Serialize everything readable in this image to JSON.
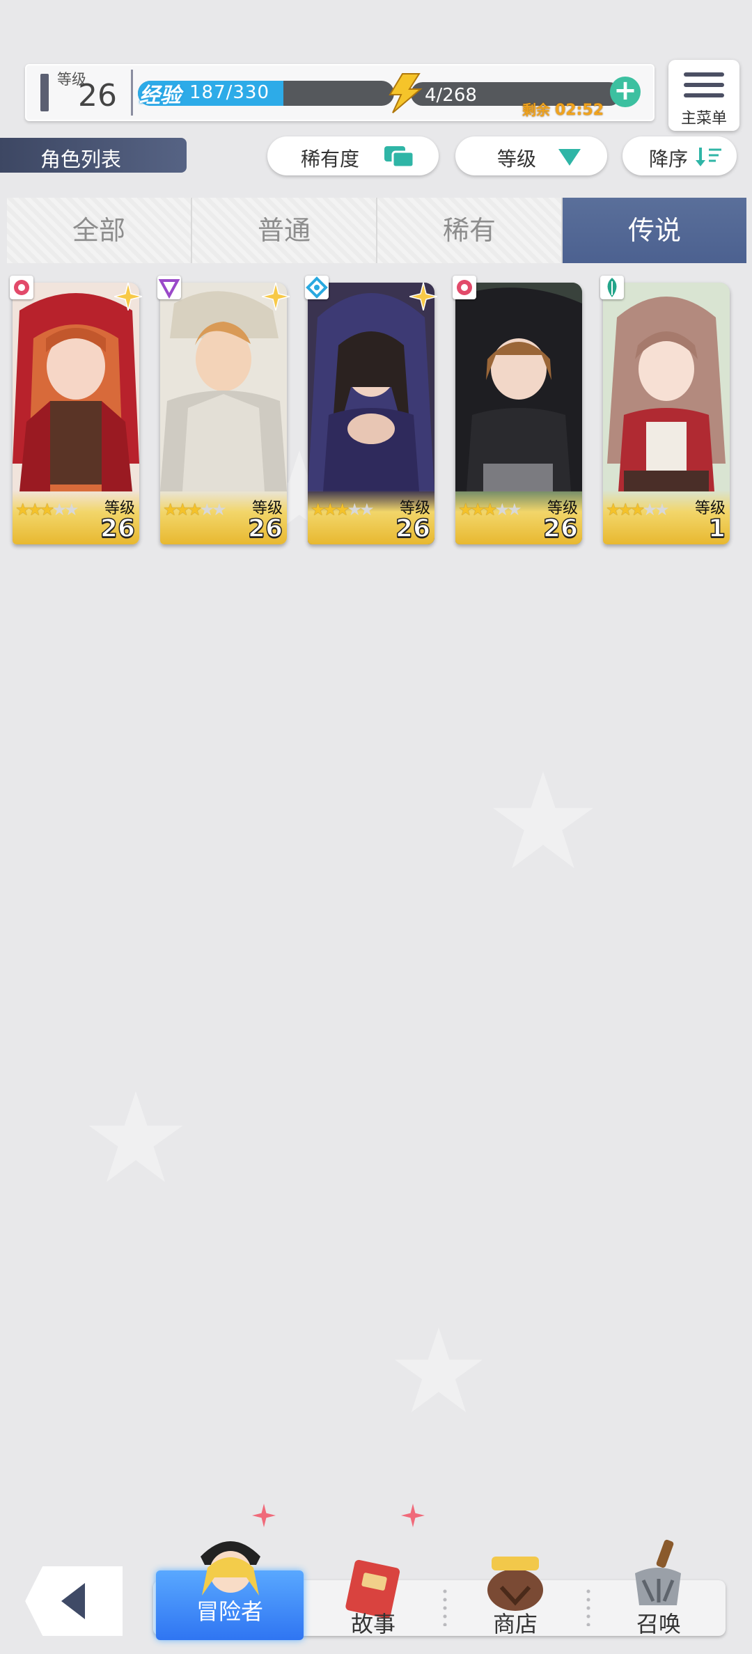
{
  "status": {
    "level_label": "等级",
    "level_value": "26",
    "exp_label": "经验",
    "exp_value": "187/330",
    "exp_progress": 0.567,
    "energy_value": "4/268",
    "remain_label": "剩余",
    "remain_time": "02:52"
  },
  "menu": {
    "label": "主菜单"
  },
  "page": {
    "title": "角色列表"
  },
  "filters": {
    "rarity_label": "稀有度",
    "level_label": "等级",
    "order_label": "降序"
  },
  "tabs": [
    {
      "label": "全部"
    },
    {
      "label": "普通"
    },
    {
      "label": "稀有"
    },
    {
      "label": "传说"
    }
  ],
  "active_tab": "传说",
  "cards": [
    {
      "level_label": "等级",
      "level": "26",
      "stars": 3,
      "element": "fire"
    },
    {
      "level_label": "等级",
      "level": "26",
      "stars": 3,
      "element": "dark"
    },
    {
      "level_label": "等级",
      "level": "26",
      "stars": 3,
      "element": "water"
    },
    {
      "level_label": "等级",
      "level": "26",
      "stars": 3,
      "element": "fire"
    },
    {
      "level_label": "等级",
      "level": "1",
      "stars": 3,
      "element": "wind"
    }
  ],
  "bottom_nav": {
    "items": [
      {
        "label": "冒险者"
      },
      {
        "label": "故事"
      },
      {
        "label": "商店"
      },
      {
        "label": "召唤"
      }
    ]
  },
  "colors": {
    "accent_blue": "#2dabe8",
    "tab_active": "#4c6190",
    "energy": "#f0a31d",
    "card_gold": "#e8b830"
  }
}
